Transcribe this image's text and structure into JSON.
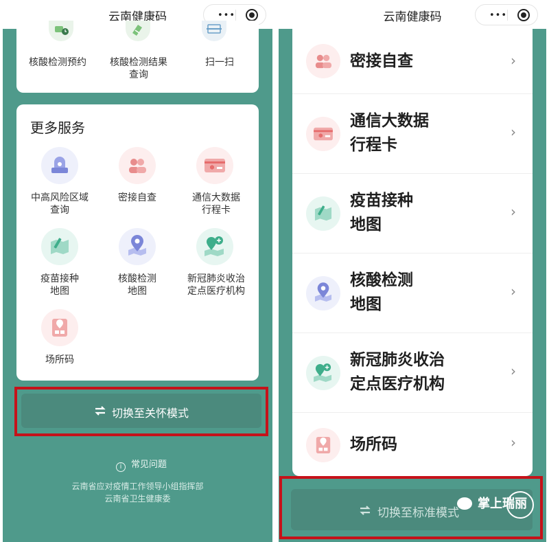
{
  "left": {
    "title": "云南健康码",
    "top_items": [
      {
        "label_1": "核酸检测预约",
        "label_2": ""
      },
      {
        "label_1": "核酸检测结果",
        "label_2": "查询"
      },
      {
        "label_1": "扫一扫",
        "label_2": ""
      }
    ],
    "more_services": {
      "title": "更多服务",
      "items": [
        {
          "label_1": "中高风险区域",
          "label_2": "查询"
        },
        {
          "label_1": "密接自查",
          "label_2": ""
        },
        {
          "label_1": "通信大数据",
          "label_2": "行程卡"
        },
        {
          "label_1": "疫苗接种",
          "label_2": "地图"
        },
        {
          "label_1": "核酸检测",
          "label_2": "地图"
        },
        {
          "label_1": "新冠肺炎收治",
          "label_2": "定点医疗机构"
        },
        {
          "label_1": "场所码",
          "label_2": ""
        }
      ]
    },
    "care_mode_label": "切换至关怀模式",
    "faq_label": "常见问题",
    "footer_line_1": "云南省应对疫情工作领导小组指挥部",
    "footer_line_2": "云南省卫生健康委"
  },
  "right": {
    "title": "云南健康码",
    "rows": [
      {
        "line_1": "密接自查",
        "line_2": ""
      },
      {
        "line_1": "通信大数据",
        "line_2": "行程卡"
      },
      {
        "line_1": "疫苗接种",
        "line_2": "地图"
      },
      {
        "line_1": "核酸检测",
        "line_2": "地图"
      },
      {
        "line_1": "新冠肺炎收治",
        "line_2": "定点医疗机构"
      },
      {
        "line_1": "场所码",
        "line_2": ""
      }
    ],
    "standard_mode_label": "切换至标准模式"
  },
  "watermark": "掌上瑞丽",
  "colors": {
    "panel_bg": "#4f9a8b",
    "button_bg": "#4b8a7d",
    "highlight_border": "#c5121a"
  }
}
